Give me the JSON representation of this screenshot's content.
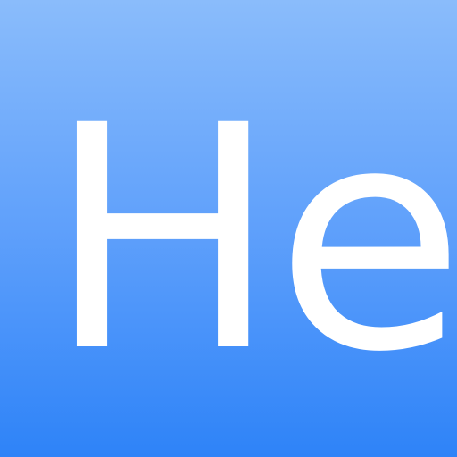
{
  "element": {
    "symbol": "He"
  },
  "colors": {
    "gradient_top": "#8abcfb",
    "gradient_middle": "#5fa0fb",
    "gradient_bottom": "#2e83f8",
    "text": "#ffffff"
  }
}
